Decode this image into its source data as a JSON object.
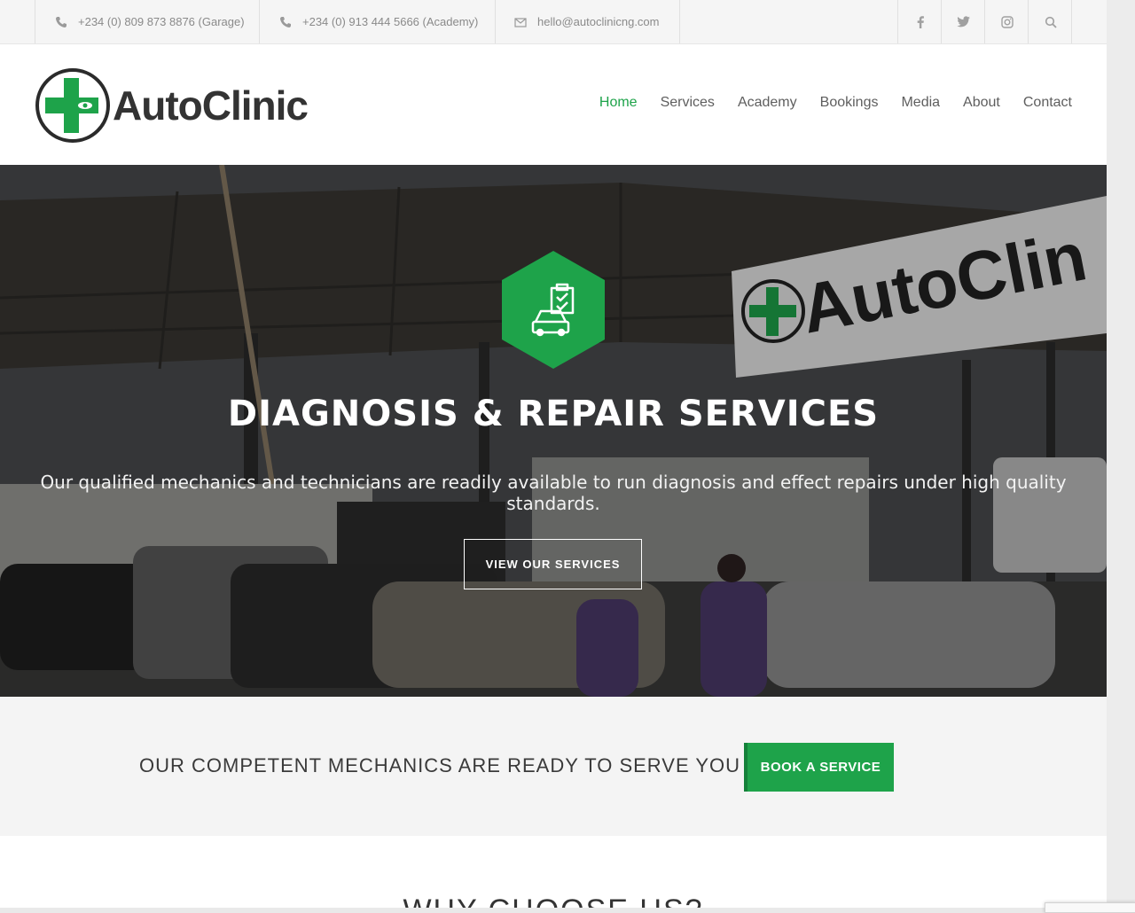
{
  "topbar": {
    "phone_garage": "+234 (0) 809 873 8876 (Garage)",
    "phone_academy": "+234 (0) 913 444 5666 (Academy)",
    "email": "hello@autoclinicng.com",
    "social": [
      "facebook-icon",
      "twitter-icon",
      "instagram-icon",
      "search-icon"
    ]
  },
  "header": {
    "logo_text": "AutoClinic",
    "nav": [
      "Home",
      "Services",
      "Academy",
      "Bookings",
      "Media",
      "About",
      "Contact"
    ],
    "active_nav": "Home"
  },
  "hero": {
    "sign_text": "AutoClin",
    "title": "DIAGNOSIS & REPAIR SERVICES",
    "subtitle": "Our qualified mechanics and technicians are readily available to run diagnosis and effect repairs under high quality standards.",
    "button": "VIEW OUR SERVICES"
  },
  "cta": {
    "text": "OUR COMPETENT MECHANICS ARE READY TO SERVE YOU",
    "button": "BOOK A SERVICE"
  },
  "section": {
    "heading": "WHY CHOOSE US?"
  },
  "colors": {
    "accent": "#1ea34a",
    "text_dark": "#333333"
  }
}
